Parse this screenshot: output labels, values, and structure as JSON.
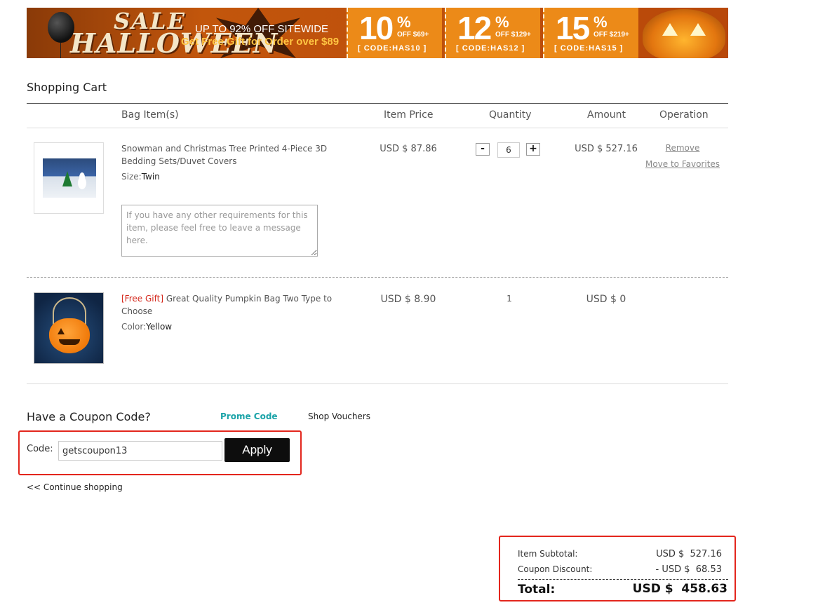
{
  "banner": {
    "sale_word": "SALE",
    "halloween_word": "HALLOWEEN",
    "headline": "UP TO 92% OFF SITEWIDE",
    "subline": "Get Free Gift for Order over $89",
    "offers": [
      {
        "pct": "10",
        "sign": "%",
        "off": "OFF $69+",
        "code": "[ CODE:HAS10 ]"
      },
      {
        "pct": "12",
        "sign": "%",
        "off": "OFF $129+",
        "code": "[ CODE:HAS12 ]"
      },
      {
        "pct": "15",
        "sign": "%",
        "off": "OFF $219+",
        "code": "[ CODE:HAS15 ]"
      }
    ]
  },
  "cart": {
    "title": "Shopping Cart",
    "columns": {
      "item": "Bag Item(s)",
      "price": "Item Price",
      "quantity": "Quantity",
      "amount": "Amount",
      "operation": "Operation"
    },
    "items": [
      {
        "name": "Snowman and Christmas Tree Printed 4-Piece 3D Bedding Sets/Duvet Covers",
        "attr_label": "Size:",
        "attr_value": "Twin",
        "price": "USD $ 87.86",
        "quantity": "6",
        "qty_minus": "-",
        "qty_plus": "+",
        "amount": "USD $ 527.16",
        "remove": "Remove",
        "favorite": "Move to Favorites",
        "message_placeholder": "If you have any other requirements for this item, please feel free to leave a message here."
      },
      {
        "tag": "[Free Gift]",
        "name": " Great Quality Pumpkin Bag Two Type to Choose",
        "attr_label": "Color:",
        "attr_value": "Yellow",
        "price": "USD $ 8.90",
        "quantity": "1",
        "amount": "USD $ 0"
      }
    ]
  },
  "coupon": {
    "title": "Have a Coupon Code?",
    "tab_prome": "Prome Code",
    "tab_voucher": "Shop Vouchers",
    "code_label": "Code:",
    "code_value": "getscoupon13",
    "apply": "Apply",
    "continue": "<< Continue shopping"
  },
  "totals": {
    "subtotal_label": "Item Subtotal:",
    "subtotal_value": "USD $  527.16",
    "discount_label": "Coupon Discount:",
    "discount_value": "- USD $  68.53",
    "total_label": "Total:",
    "total_value": "USD $  458.63"
  },
  "colors": {
    "accent_red": "#e3261d",
    "teal_tab": "#1ba3a8",
    "free_gift": "#d4281c",
    "banner_orange": "#ec8a18"
  }
}
